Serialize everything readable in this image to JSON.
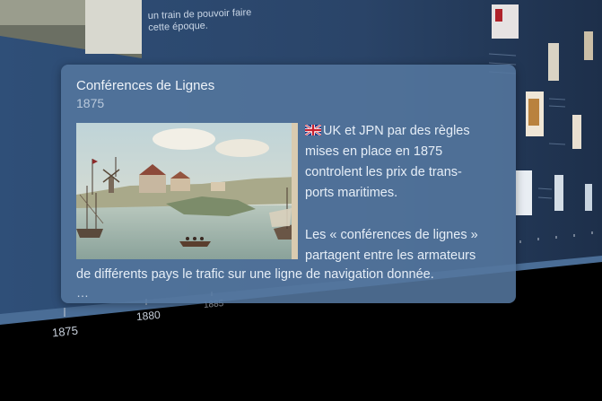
{
  "background": {
    "top_text_lines": [
      "un train de pouvoir faire",
      "cette époque."
    ],
    "axis_years": [
      "1875",
      "1880",
      "1885"
    ]
  },
  "card": {
    "title": "Conférences de Lignes",
    "year": "1875",
    "flag_icon": "uk-flag-icon",
    "paragraph1_lines": [
      "UK et JPN par des règles",
      "mises en place en 1875",
      "controlent les prix de trans-",
      "ports maritimes."
    ],
    "paragraph2_lines": [
      "Les « conférences de lignes »",
      "partagent entre les armateurs"
    ],
    "paragraph2_full_line": "de différents pays le trafic sur une ligne de navigation donnée.",
    "ellipsis": "…"
  },
  "colors": {
    "card_bg": "#54769e",
    "wall_bg": "#2e4a6e"
  }
}
